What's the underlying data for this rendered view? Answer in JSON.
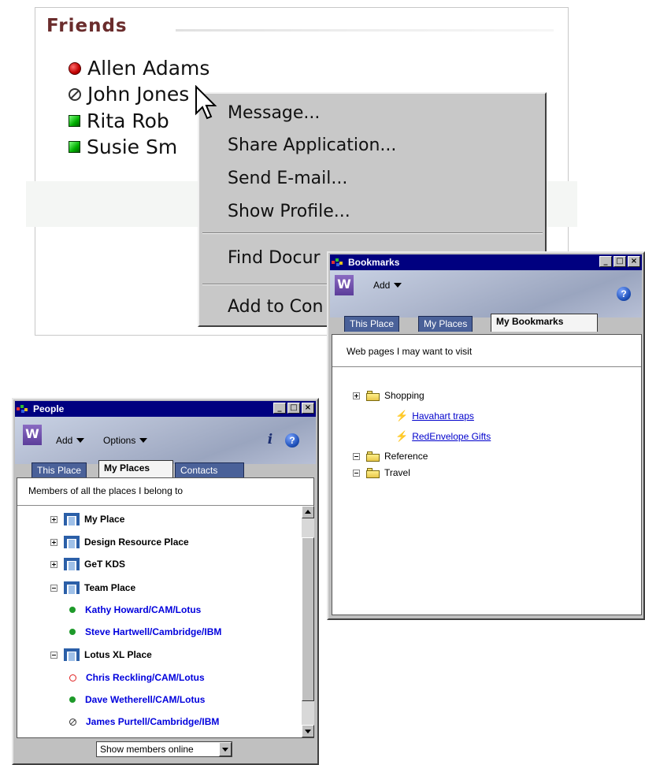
{
  "friends": {
    "title": "Friends",
    "list": [
      {
        "name": "Allen Adams",
        "status": "red"
      },
      {
        "name": "John Jones",
        "status": "away"
      },
      {
        "name": "Rita Rob",
        "status": "online"
      },
      {
        "name": "Susie Sm",
        "status": "online"
      }
    ],
    "context_menu": {
      "items": [
        "Message...",
        "Share Application...",
        "Send E-mail...",
        "Show Profile..."
      ],
      "find": "Find Docur",
      "add": "Add to Con"
    }
  },
  "bookmarks": {
    "title": "Bookmarks",
    "add_label": "Add",
    "help_label": "?",
    "tabs": [
      "This Place",
      "My Places",
      "My Bookmarks"
    ],
    "active_tab": "My Bookmarks",
    "description": "Web pages I may want to visit",
    "tree": {
      "shopping": "Shopping",
      "link1": "Havahart traps",
      "link2": "RedEnvelope Gifts",
      "reference": "Reference",
      "travel": "Travel"
    }
  },
  "people": {
    "title": "People",
    "add_label": "Add",
    "options_label": "Options",
    "help_label": "?",
    "info_label": "i",
    "tabs": [
      "This Place",
      "My Places",
      "Contacts"
    ],
    "active_tab": "My Places",
    "description": "Members of all the places I belong to",
    "places": {
      "my_place": "My Place",
      "design": "Design Resource Place",
      "get_kds": "GeT KDS",
      "team": "Team Place",
      "lotus_xl": "Lotus XL Place"
    },
    "members": {
      "kathy": "Kathy Howard/CAM/Lotus",
      "steve": "Steve Hartwell/Cambridge/IBM",
      "chris": "Chris Reckling/CAM/Lotus",
      "dave": "Dave Wetherell/CAM/Lotus",
      "james": "James Purtell/Cambridge/IBM"
    },
    "filter_select": "Show members online"
  },
  "window_buttons": {
    "minimize": "_",
    "maximize": "□",
    "close": "×"
  },
  "colors": {
    "titlebar": "#000080",
    "link": "#0000cc",
    "member": "#0000dd",
    "friends_title": "#6a2c2c"
  }
}
